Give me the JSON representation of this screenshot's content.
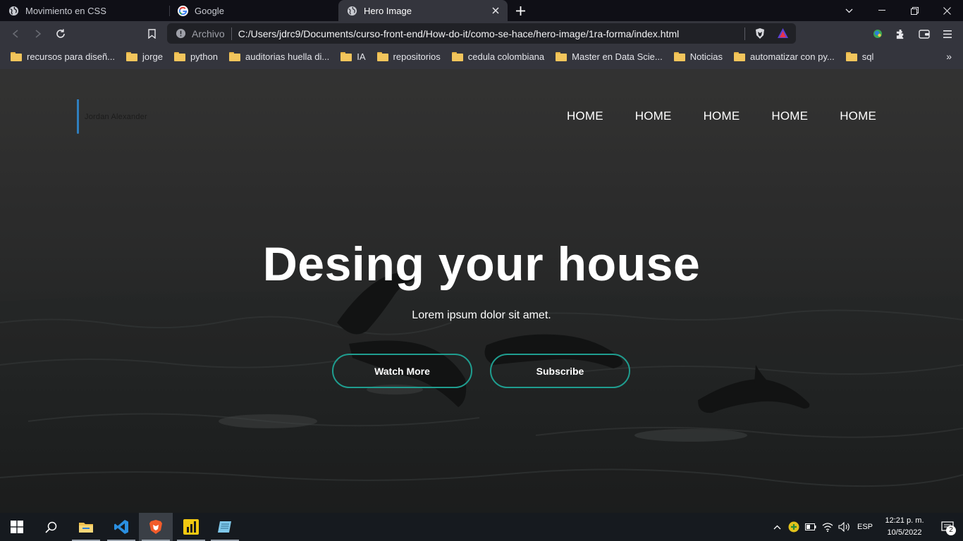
{
  "browser": {
    "tabs": [
      {
        "title": "Movimiento en CSS",
        "icon": "globe-icon",
        "active": false
      },
      {
        "title": "Google",
        "icon": "google-icon",
        "active": false
      },
      {
        "title": "Hero Image",
        "icon": "globe-icon",
        "active": true
      }
    ],
    "address": {
      "scheme_label": "Archivo",
      "url": "C:/Users/jdrc9/Documents/curso-front-end/How-do-it/como-se-hace/hero-image/1ra-forma/index.html"
    },
    "bookmarks": [
      "recursos para diseñ...",
      "jorge",
      "python",
      "auditorias huella di...",
      "IA",
      "repositorios",
      "cedula colombiana",
      "Master en Data Scie...",
      "Noticias",
      "automatizar con py...",
      "sql"
    ],
    "bookmarks_overflow": "»"
  },
  "page": {
    "logo_text": "Jordan Alexander",
    "nav": [
      "HOME",
      "HOME",
      "HOME",
      "HOME",
      "HOME"
    ],
    "headline": "Desing your house",
    "subtitle": "Lorem ipsum dolor sit amet.",
    "buttons": {
      "watch": "Watch More",
      "subscribe": "Subscribe"
    },
    "colors": {
      "accent_border": "#1f9d8f",
      "logo_bar": "#2f7fbf"
    }
  },
  "taskbar": {
    "apps": [
      "start-icon",
      "search-icon",
      "file-explorer-icon",
      "vscode-icon",
      "brave-icon",
      "powerbi-icon",
      "notepad-icon"
    ],
    "language": "ESP",
    "time": "12:21 p. m.",
    "date": "10/5/2022",
    "notifications": "2"
  }
}
